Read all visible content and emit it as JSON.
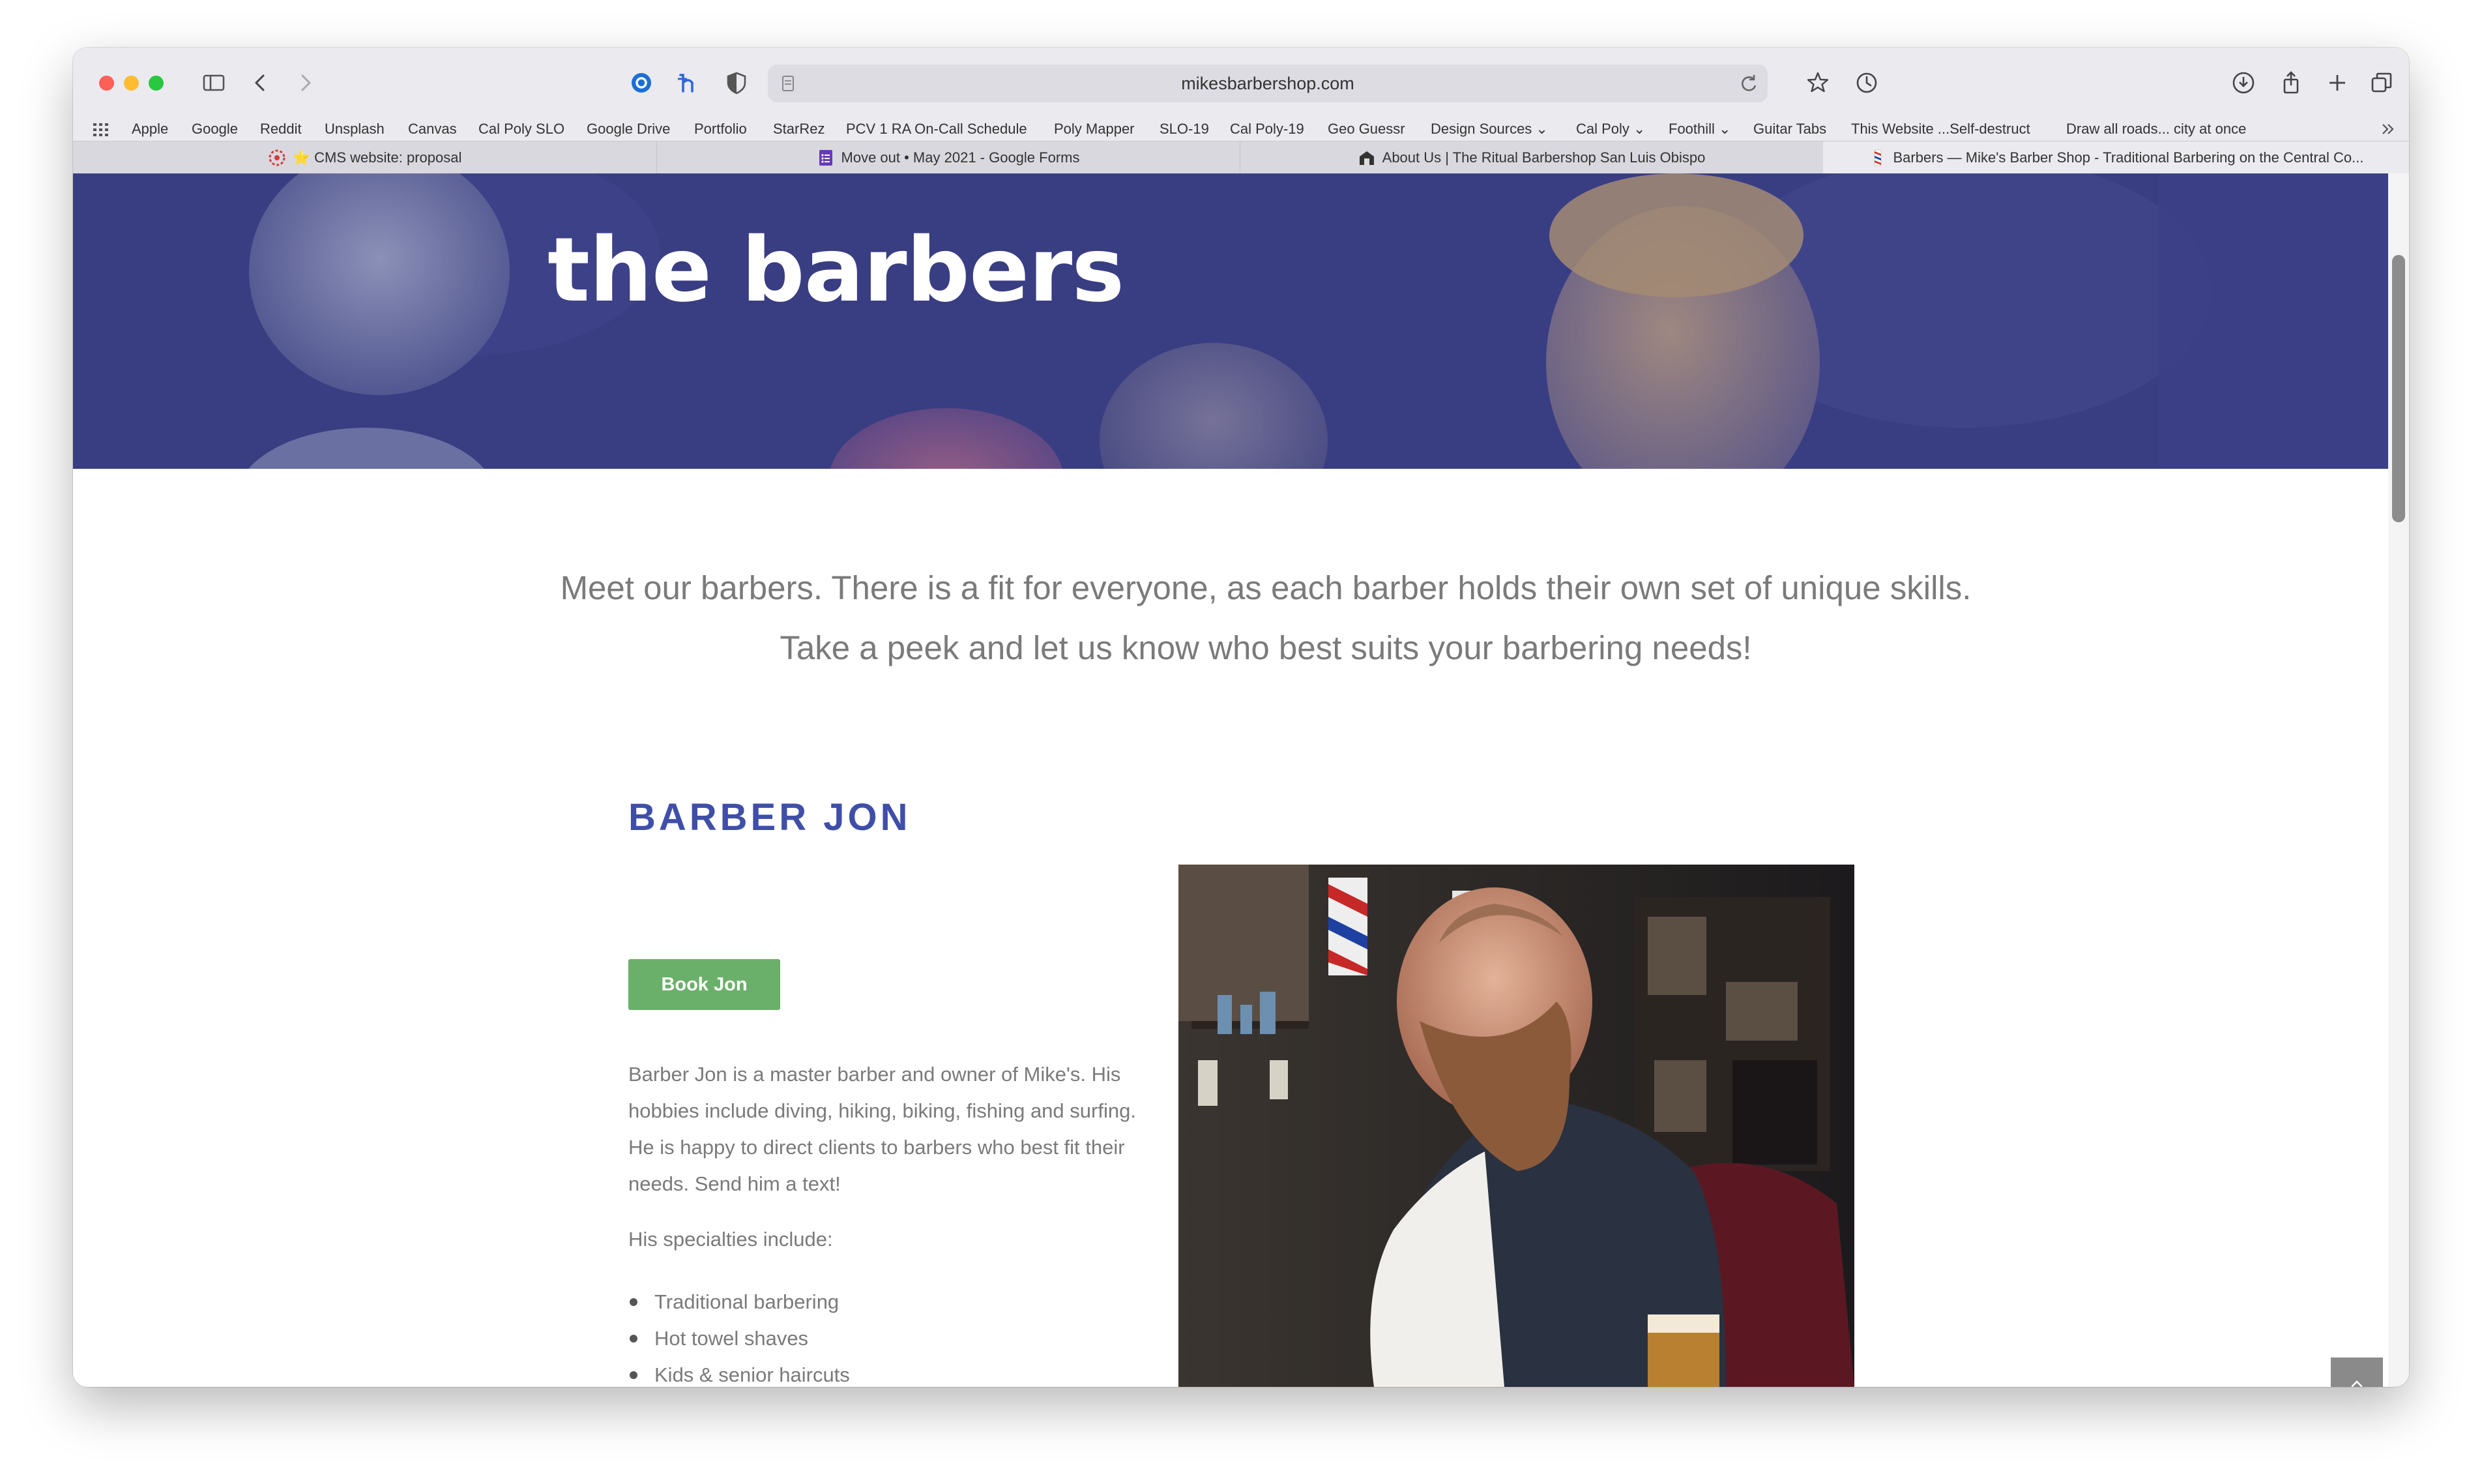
{
  "browser": {
    "url": "mikesbarbershop.com",
    "bookmarks": [
      "Apple",
      "Google",
      "Reddit",
      "Unsplash",
      "Canvas",
      "Cal Poly SLO",
      "Google Drive",
      "Portfolio",
      "StarRez",
      "PCV 1 RA On-Call Schedule",
      "Poly Mapper",
      "SLO-19",
      "Cal Poly-19",
      "Geo Guessr",
      "Design Sources ⌄",
      "Cal Poly ⌄",
      "Foothill ⌄",
      "Guitar Tabs",
      "This Website ...Self-destruct",
      "Draw all roads... city at once"
    ],
    "tabs": [
      {
        "label": "⭐ CMS website: proposal"
      },
      {
        "label": "Move out • May 2021 - Google Forms"
      },
      {
        "label": "About Us | The Ritual Barbershop San Luis Obispo"
      },
      {
        "label": "Barbers — Mike's Barber Shop - Traditional Barbering on the Central Co..."
      }
    ],
    "active_tab_index": 3
  },
  "page": {
    "hero_title": "the barbers",
    "intro": "Meet our barbers. There is a fit for everyone, as each barber holds their own set of unique skills. Take a peek and let us know who best suits your barbering needs!",
    "barber": {
      "name": "BARBER JON",
      "book_label": "Book Jon",
      "bio": "Barber Jon is a master barber and owner of Mike's. His hobbies include diving, hiking, biking, fishing and surfing. He is happy to direct clients to barbers who best fit their needs. Send him a text!",
      "specialties_intro": "His specialties include:",
      "specialties": [
        "Traditional barbering",
        "Hot towel shaves",
        "Kids & senior haircuts"
      ]
    }
  },
  "colors": {
    "accent": "#3f4fa8",
    "button": "#6ab06a",
    "hero_tint": "#3b3f85",
    "body_text": "#7a7a7a"
  }
}
